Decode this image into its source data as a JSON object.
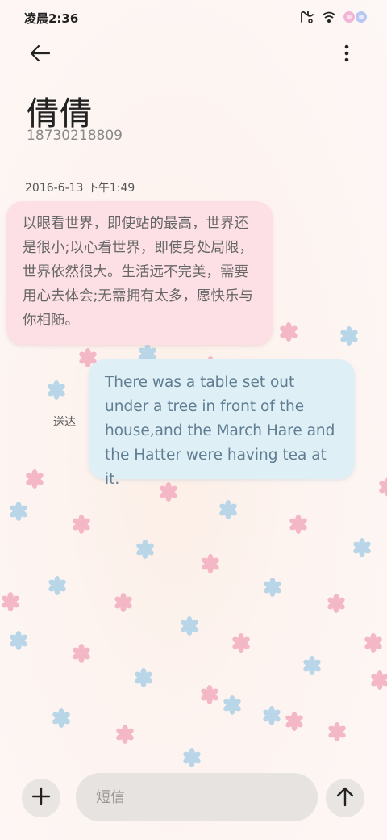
{
  "status_bar": {
    "time": "凌晨2:36",
    "icons": [
      "nfc-icon",
      "wifi-icon",
      "battery-flower-icon"
    ]
  },
  "header": {
    "back_icon": "arrow-left-icon",
    "more_icon": "more-vertical-icon",
    "contact_name": "倩倩",
    "contact_number": "18730218809"
  },
  "conversation": {
    "timestamp": "2016-6-13 下午1:49",
    "messages": [
      {
        "direction": "incoming",
        "text": "以眼看世界，即使站的最高，世界还是很小;以心看世界，即使身处局限，世界依然很大。生活远不完美，需要用心去体会;无需拥有太多，愿快乐与你相随。"
      },
      {
        "direction": "outgoing",
        "status": "送达",
        "text": "There was a table set out under a tree in front of the house,and the March Hare and the Hatter were having tea at it."
      }
    ]
  },
  "composer": {
    "add_icon": "plus-icon",
    "placeholder": "短信",
    "value": "",
    "send_icon": "arrow-up-icon"
  },
  "colors": {
    "incoming_bubble": "#fde0e5",
    "outgoing_bubble": "#dfeff6",
    "outgoing_text": "#607d92",
    "pink_flake": "#f4b7c6",
    "blue_flake": "#b8d6e8"
  }
}
